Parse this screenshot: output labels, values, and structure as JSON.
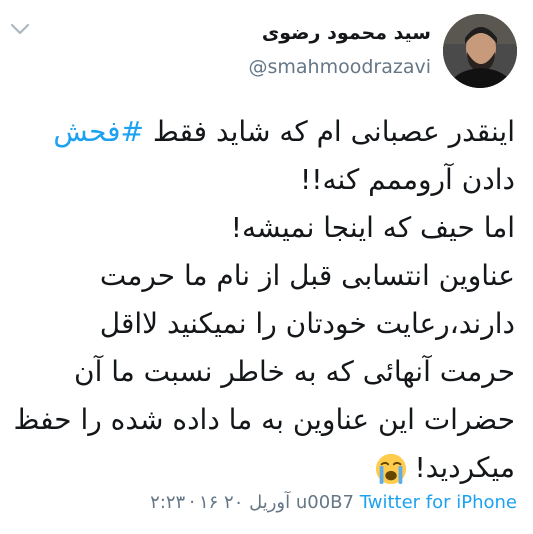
{
  "header": {
    "display_name": "سید محمود رضوی",
    "handle": "@smahmoodrazavi"
  },
  "icons": {
    "chevron": "chevron-down-icon",
    "emoji": "crying-face-icon"
  },
  "tweet": {
    "line1_text": "اینقدر عصبانی ام که شاید فقط ",
    "hashtag": "#فحش",
    "line2": "دادن آروممم کنه!!",
    "line3": "اما حیف که اینجا نمیشه!",
    "line4": "عناوین انتسابی قبل از نام ما حرمت",
    "line5": "دارند،رعایت خودتان را نمیکنید لااقل",
    "line6": "حرمت آنهائی که به خاطر نسبت ما آن",
    "line7": "حضرات این عناوین به ما داده شده را حفظ",
    "line8": "میکردید!"
  },
  "footer": {
    "time": "۲:۲۳",
    "date": "۱۶ آوریل ۲۰",
    "separator": "u00B7",
    "source": "Twitter for iPhone"
  },
  "colors": {
    "link": "#1da1f2",
    "secondary": "#657786",
    "text": "#14171a"
  }
}
